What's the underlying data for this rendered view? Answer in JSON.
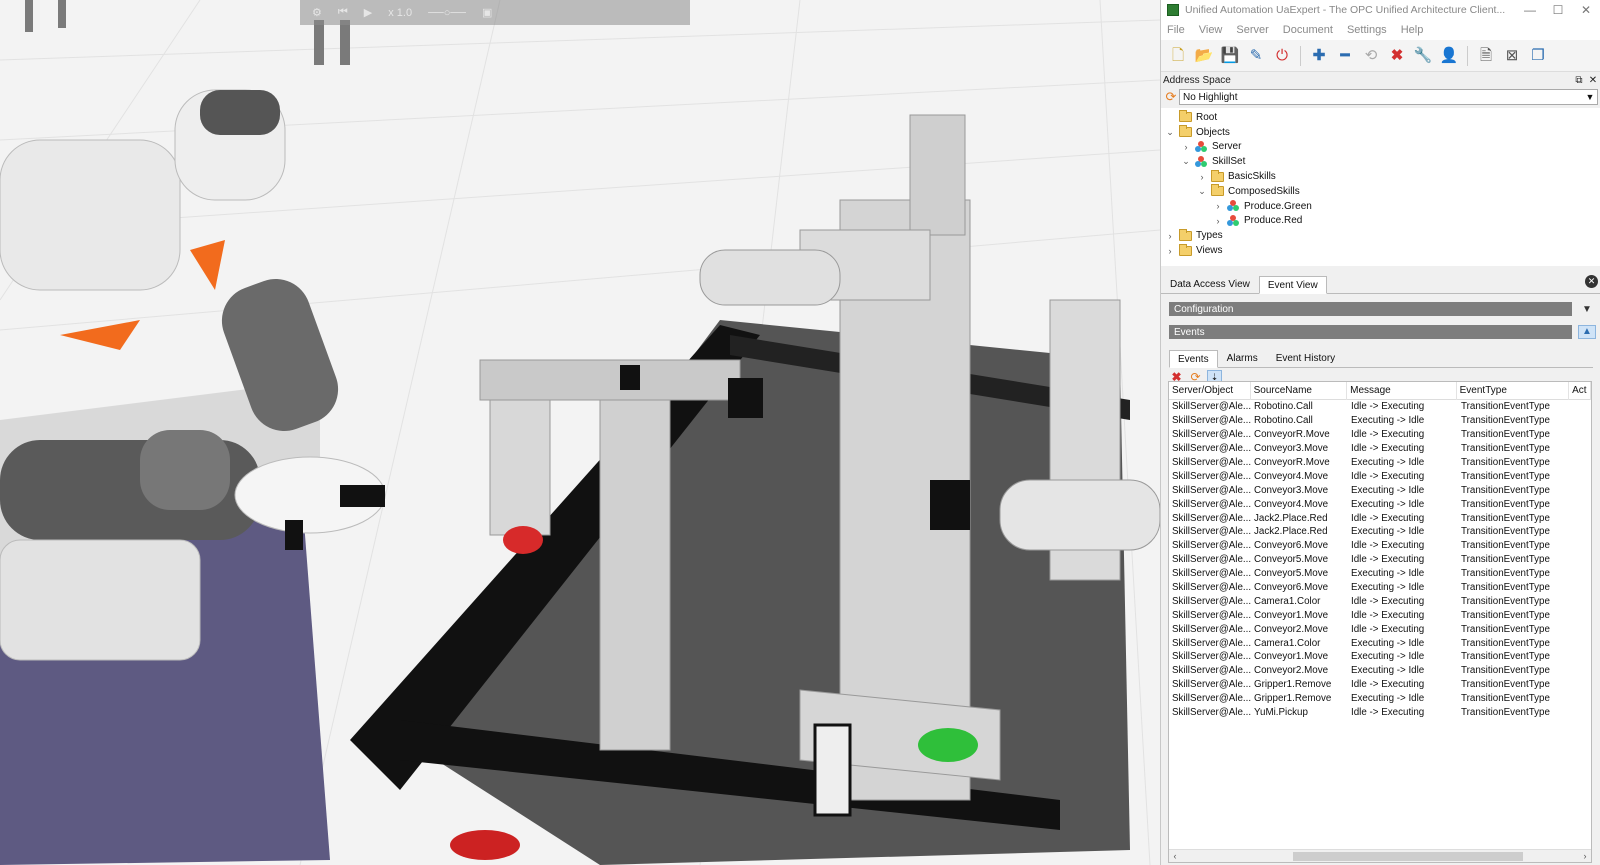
{
  "simulation": {
    "toolbar_speed": "x 1.0"
  },
  "window": {
    "title": "Unified Automation UaExpert - The OPC Unified Architecture Client...",
    "minimize": "—",
    "maximize": "☐",
    "close": "✕"
  },
  "menu": [
    "File",
    "View",
    "Server",
    "Document",
    "Settings",
    "Help"
  ],
  "toolbar_icons": [
    "new-document-icon",
    "open-icon",
    "save-icon",
    "save-as-icon",
    "power-icon",
    "add-server-icon",
    "remove-server-icon",
    "connect-icon",
    "disconnect-icon",
    "settings-icon",
    "user-icon",
    "report-icon",
    "delete-icon",
    "window-icon"
  ],
  "address_space": {
    "title": "Address Space",
    "highlight_value": "No Highlight",
    "tree": [
      {
        "label": "Root",
        "depth": 0,
        "expander": "",
        "icon": "folder"
      },
      {
        "label": "Objects",
        "depth": 0,
        "expander": "⌄",
        "icon": "folder"
      },
      {
        "label": "Server",
        "depth": 1,
        "expander": "›",
        "icon": "object"
      },
      {
        "label": "SkillSet",
        "depth": 1,
        "expander": "⌄",
        "icon": "object"
      },
      {
        "label": "BasicSkills",
        "depth": 2,
        "expander": "›",
        "icon": "folder"
      },
      {
        "label": "ComposedSkills",
        "depth": 2,
        "expander": "⌄",
        "icon": "folder"
      },
      {
        "label": "Produce.Green",
        "depth": 3,
        "expander": "›",
        "icon": "object"
      },
      {
        "label": "Produce.Red",
        "depth": 3,
        "expander": "›",
        "icon": "object"
      },
      {
        "label": "Types",
        "depth": 0,
        "expander": "›",
        "icon": "folder"
      },
      {
        "label": "Views",
        "depth": 0,
        "expander": "›",
        "icon": "folder"
      }
    ]
  },
  "lower_tabs": [
    {
      "label": "Data Access View",
      "active": false
    },
    {
      "label": "Event View",
      "active": true
    }
  ],
  "sections": {
    "configuration": "Configuration",
    "events": "Events"
  },
  "event_tabs": [
    {
      "label": "Events",
      "active": true
    },
    {
      "label": "Alarms",
      "active": false
    },
    {
      "label": "Event History",
      "active": false
    }
  ],
  "event_table": {
    "columns": [
      "Server/Object",
      "SourceName",
      "Message",
      "EventType",
      "Act"
    ],
    "rows": [
      [
        "SkillServer@Ale...",
        "Robotino.Call",
        "Idle -> Executing",
        "TransitionEventType"
      ],
      [
        "SkillServer@Ale...",
        "Robotino.Call",
        "Executing -> Idle",
        "TransitionEventType"
      ],
      [
        "SkillServer@Ale...",
        "ConveyorR.Move",
        "Idle -> Executing",
        "TransitionEventType"
      ],
      [
        "SkillServer@Ale...",
        "Conveyor3.Move",
        "Idle -> Executing",
        "TransitionEventType"
      ],
      [
        "SkillServer@Ale...",
        "ConveyorR.Move",
        "Executing -> Idle",
        "TransitionEventType"
      ],
      [
        "SkillServer@Ale...",
        "Conveyor4.Move",
        "Idle -> Executing",
        "TransitionEventType"
      ],
      [
        "SkillServer@Ale...",
        "Conveyor3.Move",
        "Executing -> Idle",
        "TransitionEventType"
      ],
      [
        "SkillServer@Ale...",
        "Conveyor4.Move",
        "Executing -> Idle",
        "TransitionEventType"
      ],
      [
        "SkillServer@Ale...",
        "Jack2.Place.Red",
        "Idle -> Executing",
        "TransitionEventType"
      ],
      [
        "SkillServer@Ale...",
        "Jack2.Place.Red",
        "Executing -> Idle",
        "TransitionEventType"
      ],
      [
        "SkillServer@Ale...",
        "Conveyor6.Move",
        "Idle -> Executing",
        "TransitionEventType"
      ],
      [
        "SkillServer@Ale...",
        "Conveyor5.Move",
        "Idle -> Executing",
        "TransitionEventType"
      ],
      [
        "SkillServer@Ale...",
        "Conveyor5.Move",
        "Executing -> Idle",
        "TransitionEventType"
      ],
      [
        "SkillServer@Ale...",
        "Conveyor6.Move",
        "Executing -> Idle",
        "TransitionEventType"
      ],
      [
        "SkillServer@Ale...",
        "Camera1.Color",
        "Idle -> Executing",
        "TransitionEventType"
      ],
      [
        "SkillServer@Ale...",
        "Conveyor1.Move",
        "Idle -> Executing",
        "TransitionEventType"
      ],
      [
        "SkillServer@Ale...",
        "Conveyor2.Move",
        "Idle -> Executing",
        "TransitionEventType"
      ],
      [
        "SkillServer@Ale...",
        "Camera1.Color",
        "Executing -> Idle",
        "TransitionEventType"
      ],
      [
        "SkillServer@Ale...",
        "Conveyor1.Move",
        "Executing -> Idle",
        "TransitionEventType"
      ],
      [
        "SkillServer@Ale...",
        "Conveyor2.Move",
        "Executing -> Idle",
        "TransitionEventType"
      ],
      [
        "SkillServer@Ale...",
        "Gripper1.Remove",
        "Idle -> Executing",
        "TransitionEventType"
      ],
      [
        "SkillServer@Ale...",
        "Gripper1.Remove",
        "Executing -> Idle",
        "TransitionEventType"
      ],
      [
        "SkillServer@Ale...",
        "YuMi.Pickup",
        "Idle -> Executing",
        "TransitionEventType"
      ]
    ]
  },
  "colors": {
    "section_bar": "#7d7d7d",
    "accent_blue": "#2b6cb0",
    "delete_red": "#d32f2f",
    "sync_orange": "#e67e22",
    "part_green": "#2fbf3a",
    "part_red": "#d72a2a",
    "robot_orange": "#f26b1d",
    "table_purple": "#5e5a82"
  }
}
